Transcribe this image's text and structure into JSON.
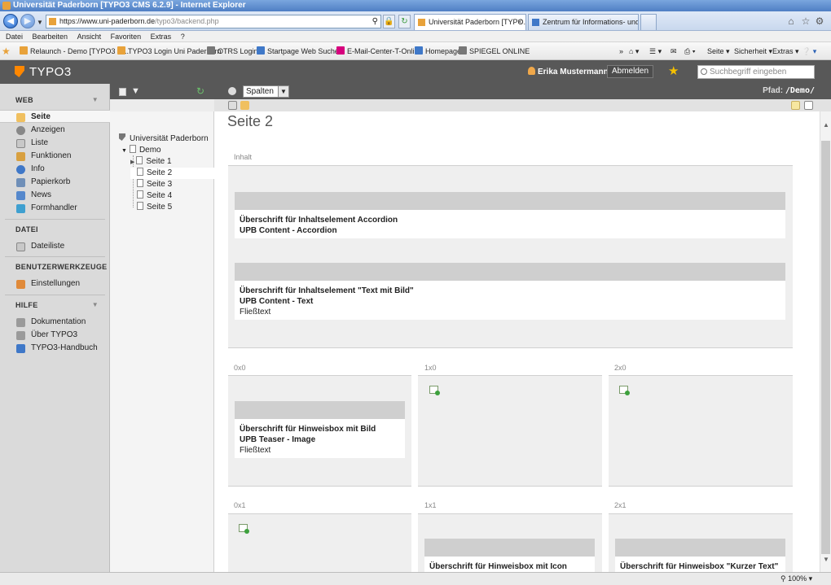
{
  "browser": {
    "title": "Universität Paderborn [TYPO3 CMS 6.2.9] - Internet Explorer",
    "address_pre": "https://",
    "address_host": "www.uni-paderborn.de",
    "address_path": "/typo3/backend.php",
    "tabs": [
      {
        "label": "Universität Paderborn [TYPO..."
      },
      {
        "label": "Zentrum für Informations- und ..."
      }
    ],
    "menu": [
      "Datei",
      "Bearbeiten",
      "Ansicht",
      "Favoriten",
      "Extras",
      "?"
    ],
    "favorites": [
      "Relaunch - Demo [TYPO3 C...",
      "TYPO3 Login Uni Paderborn",
      "OTRS  Login",
      "Startpage Web Suchen",
      "E-Mail-Center-T-Online",
      "Homepage",
      "SPIEGEL ONLINE"
    ],
    "commands": [
      "Seite ▾",
      "Sicherheit ▾",
      "Extras ▾"
    ],
    "zoom": "100%"
  },
  "typo3": {
    "brand": "TYPO3",
    "user": "Erika Mustermann",
    "logout": "Abmelden",
    "search_placeholder": "Suchbegriff eingeben",
    "path_label": "Pfad:",
    "path_value": "/Demo/",
    "column_select": "Spalten"
  },
  "modules": {
    "web": {
      "label": "WEB",
      "items": [
        "Seite",
        "Anzeigen",
        "Liste",
        "Funktionen",
        "Info",
        "Papierkorb",
        "News",
        "Formhandler"
      ]
    },
    "datei": {
      "label": "DATEI",
      "items": [
        "Dateiliste"
      ]
    },
    "benutzer": {
      "label": "BENUTZERWERKZEUGE",
      "items": [
        "Einstellungen"
      ]
    },
    "hilfe": {
      "label": "HILFE",
      "items": [
        "Dokumentation",
        "Über TYPO3",
        "TYPO3-Handbuch"
      ]
    }
  },
  "tree": {
    "root": "Universität Paderborn",
    "demo": "Demo",
    "pages": [
      "Seite 1",
      "Seite 2",
      "Seite 3",
      "Seite 4",
      "Seite 5"
    ]
  },
  "content": {
    "page_title": "Seite 2",
    "inhalt_label": "Inhalt",
    "ce1": {
      "heading": "Überschrift für Inhaltselement Accordion",
      "type": "UPB Content - Accordion"
    },
    "ce2": {
      "heading": "Überschrift für Inhaltselement \"Text mit Bild\"",
      "type": "UPB Content - Text",
      "body": "Fließtext"
    },
    "grid": {
      "c00": "0x0",
      "c10": "1x0",
      "c20": "2x0",
      "c01": "0x1",
      "c11": "1x1",
      "c21": "2x1"
    },
    "ce3": {
      "heading": "Überschrift für Hinweisbox mit Bild",
      "type": "UPB Teaser - Image",
      "body": "Fließtext"
    },
    "ce4": {
      "heading": "Überschrift für Hinweisbox mit Icon"
    },
    "ce5": {
      "heading": "Überschrift für Hinweisbox \"Kurzer Text\""
    }
  }
}
